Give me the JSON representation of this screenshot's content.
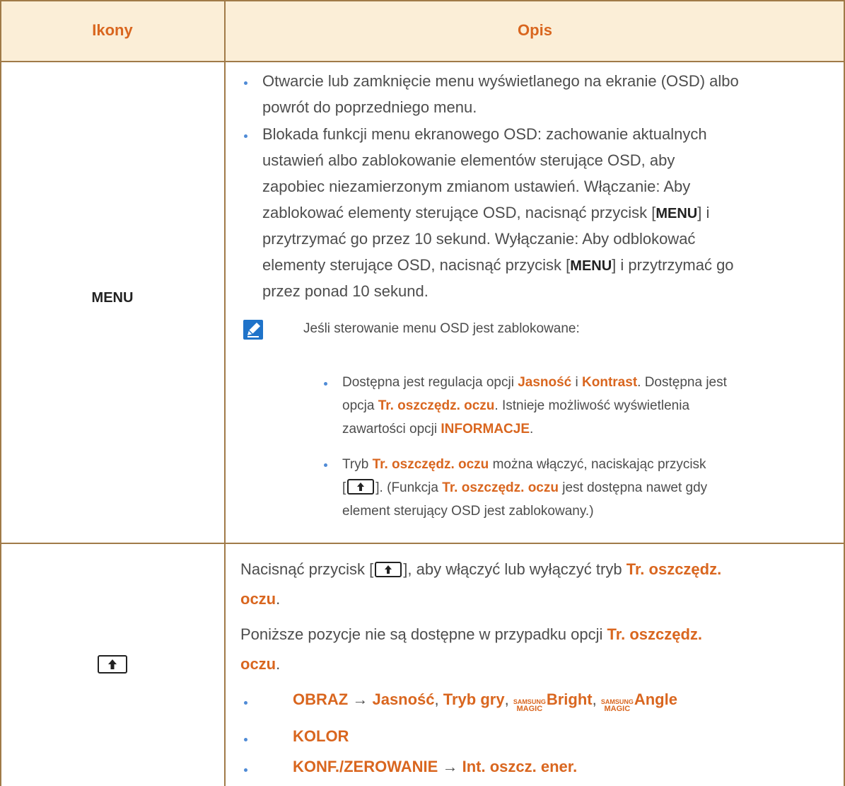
{
  "table": {
    "header": {
      "col1": "Ikony",
      "col2": "Opis"
    },
    "rows": [
      {
        "icon_label": "MENU",
        "bullet1": "Otwarcie lub zamknięcie menu wyświetlanego na ekranie (OSD) albo",
        "bullet1b": "powrót do poprzedniego menu.",
        "bullet2_lines": [
          "Blokada funkcji menu ekranowego OSD: zachowanie aktualnych",
          "ustawień albo zablokowanie elementów sterujące OSD, aby",
          "zapobiec niezamierzonym zmianom ustawień. Włączanie: Aby"
        ],
        "line4a": "zablokować elementy sterujące OSD, nacisnąć przycisk [",
        "menu_key": "MENU",
        "line4b": "] i",
        "line5": "przytrzymać go przez 10 sekund. Wyłączanie: Aby odblokować",
        "line6a": "elementy sterujące OSD, nacisnąć przycisk [",
        "line6b": "] i przytrzymać go",
        "line7": "przez ponad 10 sekund.",
        "note_title": "Jeśli sterowanie menu OSD jest zablokowane:",
        "note_b1_a": "Dostępna jest regulacja opcji ",
        "note_b1_jasnosc": "Jasność",
        "note_b1_i": " i ",
        "note_b1_kontrast": "Kontrast",
        "note_b1_b": ". Dostępna jest",
        "note_b1_c": "opcja ",
        "note_b1_tr": "Tr. oszczędz. oczu",
        "note_b1_d": ". Istnieje możliwość wyświetlenia",
        "note_b1_e": "zawartości opcji ",
        "note_b1_info": "INFORMACJE",
        "note_b1_f": ".",
        "note_b2_a": "Tryb ",
        "note_b2_tr": "Tr. oszczędz. oczu",
        "note_b2_b": " można włączyć, naciskając przycisk",
        "note_b2_c1": "[",
        "note_b2_c2": "]. (Funkcja ",
        "note_b2_tr2": "Tr. oszczędz. oczu",
        "note_b2_d": " jest dostępna nawet gdy",
        "note_b2_e": "element sterujący OSD jest zablokowany.)"
      },
      {
        "p1_a": "Nacisnąć przycisk [",
        "p1_b": "], aby włączyć lub wyłączyć tryb ",
        "p1_tr": "Tr. oszczędz.",
        "p1_oczu": "oczu",
        "p1_dot": ".",
        "p2_a": "Poniższe pozycje nie są dostępne w przypadku opcji ",
        "p2_tr": "Tr. oszczędz.",
        "p2_oczu": "oczu",
        "p2_dot": ".",
        "item1_obraz": "OBRAZ",
        "arrow": "→",
        "item1_jasnosc": "Jasność",
        "comma": ", ",
        "item1_tryb": "Tryb gry",
        "samsung": "SAMSUNG",
        "magic": "MAGIC",
        "item1_bright": "Bright",
        "item1_angle": "Angle",
        "item2": "KOLOR",
        "item3_konf": "KONF./ZEROWANIE",
        "item3_int": "Int. oszcz. ener."
      }
    ]
  },
  "colors": {
    "accent": "#d9661f",
    "header_bg": "#fbeed7",
    "border": "#a07a48",
    "bullet": "#4f8bd6",
    "note_icon": "#1f73c9"
  }
}
